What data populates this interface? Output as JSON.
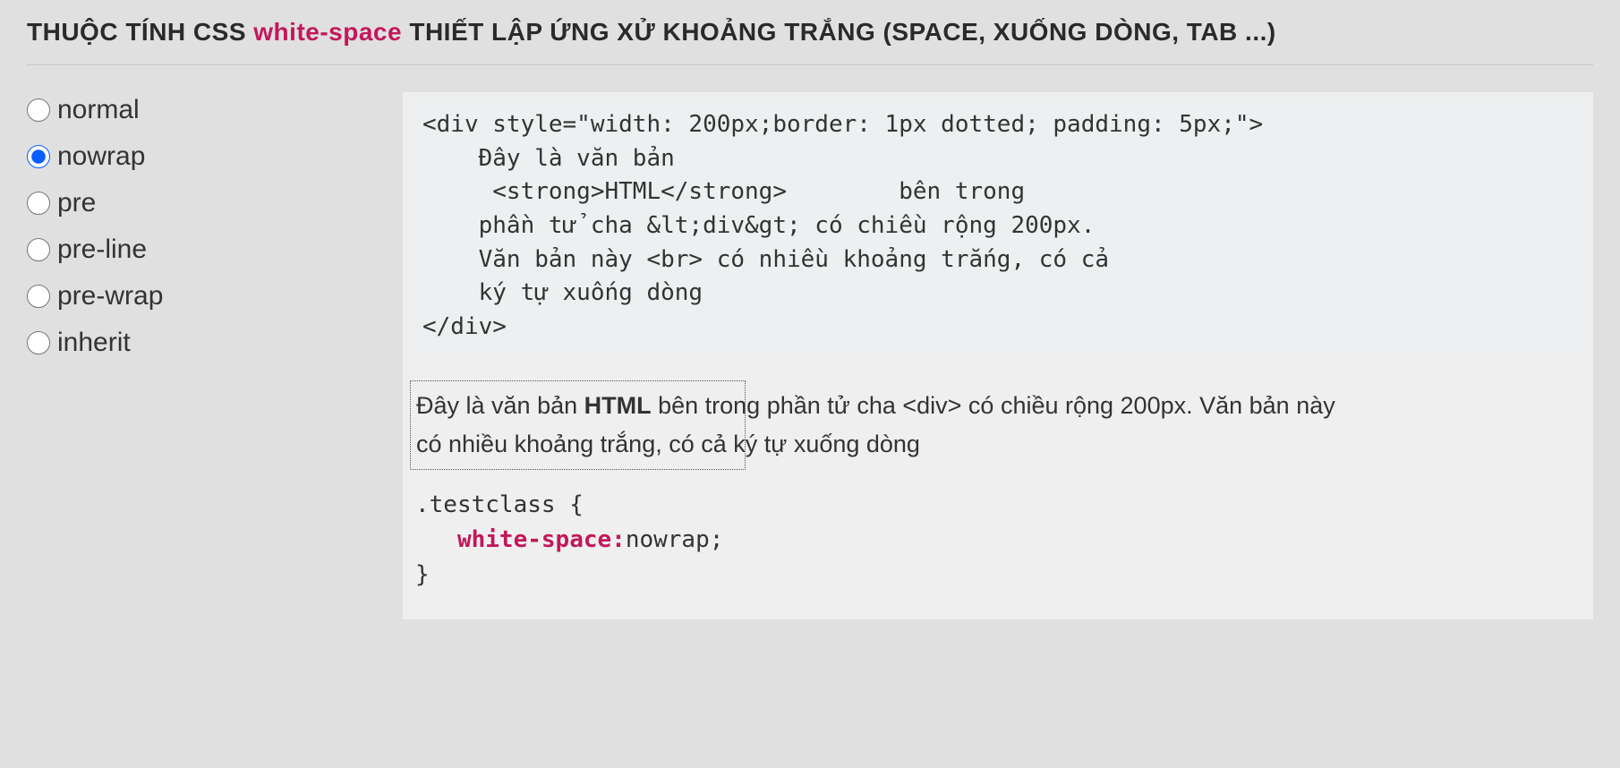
{
  "header": {
    "title_pre": "THUỘC TÍNH CSS ",
    "title_accent": "white-space",
    "title_post": " THIẾT LẬP ỨNG XỬ KHOẢNG TRẮNG (SPACE, XUỐNG DÒNG, TAB ...)"
  },
  "sidebar": {
    "options": [
      {
        "value": "normal",
        "label": "normal",
        "checked": false
      },
      {
        "value": "nowrap",
        "label": "nowrap",
        "checked": true
      },
      {
        "value": "pre",
        "label": "pre",
        "checked": false
      },
      {
        "value": "pre-line",
        "label": "pre-line",
        "checked": false
      },
      {
        "value": "pre-wrap",
        "label": "pre-wrap",
        "checked": false
      },
      {
        "value": "inherit",
        "label": "inherit",
        "checked": false
      }
    ]
  },
  "code": {
    "html_source": "<div style=\"width: 200px;border: 1px dotted; padding: 5px;\">\n    Đây là văn bản\n     <strong>HTML</strong>        bên trong\n    phần tử cha &lt;div&gt; có chiều rộng 200px.\n    Văn bản này <br> có nhiều khoảng trắng, có cả\n    ký tự xuống dòng\n</div>"
  },
  "preview": {
    "white_space": "nowrap",
    "text_pre": "Đây là văn bản ",
    "text_strong": "HTML",
    "text_mid": " bên trong phần tử cha <div> có chiều rộng 200px. Văn bản này ",
    "text_post": "có nhiều khoảng trắng, có cả ký tự xuống dòng"
  },
  "css_out": {
    "selector": ".testclass",
    "open": "{",
    "close": "}",
    "indent": "   ",
    "property": "white-space:",
    "value": "nowrap;"
  }
}
